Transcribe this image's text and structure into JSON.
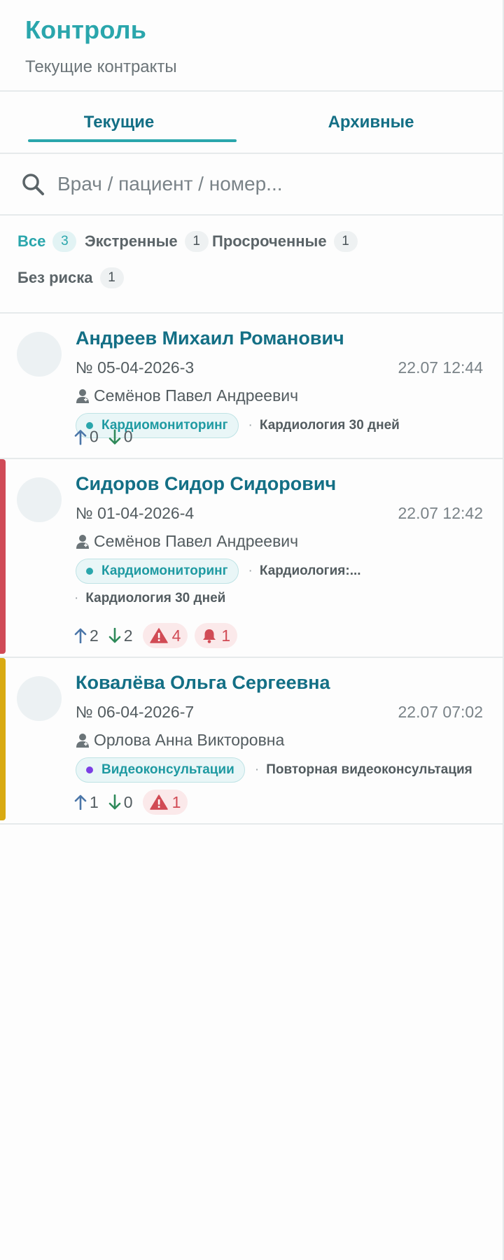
{
  "header": {
    "title": "Контроль",
    "subtitle": "Текущие контракты"
  },
  "tabs": [
    {
      "label": "Текущие",
      "active": true
    },
    {
      "label": "Архивные",
      "active": false
    }
  ],
  "search": {
    "placeholder": "Врач / пациент / номер...",
    "value": ""
  },
  "filters": [
    {
      "label": "Все",
      "count": "3",
      "active": true
    },
    {
      "label": "Экстренные",
      "count": "1",
      "active": false
    },
    {
      "label": "Просроченные",
      "count": "1",
      "active": false
    },
    {
      "label": "Без риска",
      "count": "1",
      "active": false
    }
  ],
  "colors": {
    "accent": "#2aa6ac",
    "name": "#136f85",
    "danger": "#d14b55",
    "stripe_red": "#d04a57",
    "stripe_yellow": "#d9aa12"
  },
  "contracts": [
    {
      "patient": "Андреев Михаил Романович",
      "number": "№ 05-04-2026-3",
      "date": "22.07 12:44",
      "doctor": "Семёнов Павел Андреевич",
      "tag": "Кардиомониторинг",
      "programs": [
        "Кардиология 30 дней"
      ],
      "up": "0",
      "down": "0",
      "warnings": "",
      "alarms": ""
    },
    {
      "patient": "Сидоров Сидор Сидорович",
      "number": "№ 01-04-2026-4",
      "date": "22.07 12:42",
      "doctor": "Семёнов Павел Андреевич",
      "tag": "Кардиомониторинг",
      "programs": [
        "Кардиология:...",
        "Кардиология 30 дней"
      ],
      "up": "2",
      "down": "2",
      "warnings": "4",
      "alarms": "1",
      "stripe": "red"
    },
    {
      "patient": "Ковалёва Ольга Сергеевна",
      "number": "№ 06-04-2026-7",
      "date": "22.07 07:02",
      "doctor": "Орлова Анна Викторовна",
      "tag": "Видеоконсультации",
      "programs": [
        "Повторная видеоконсультация"
      ],
      "up": "1",
      "down": "0",
      "warnings": "1",
      "alarms": "",
      "stripe": "yellow"
    }
  ]
}
